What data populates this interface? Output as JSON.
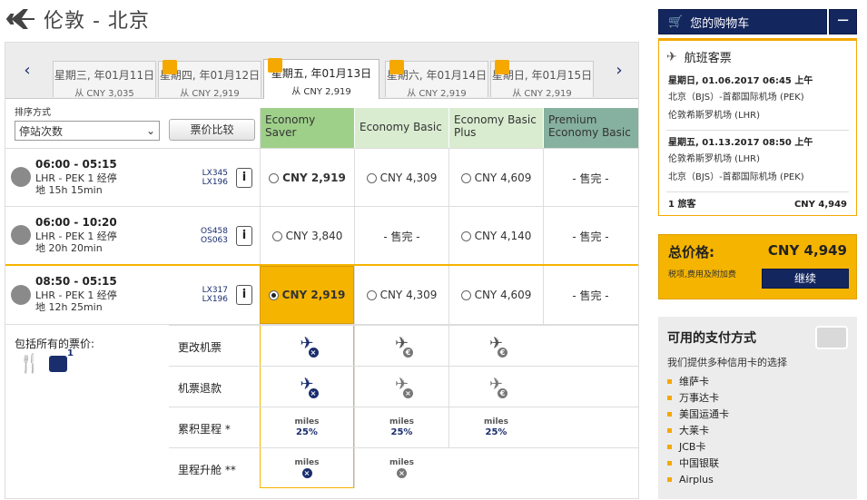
{
  "page": {
    "title": "伦敦 - 北京"
  },
  "datebar": {
    "prev": "‹",
    "next": "›",
    "tabs": [
      {
        "date": "星期三, 年01月11日",
        "price": "从 CNY 3,035",
        "flag": false,
        "selected": false
      },
      {
        "date": "星期四, 年01月12日",
        "price": "从 CNY 2,919",
        "flag": true,
        "selected": false
      },
      {
        "date": "星期五, 年01月13日",
        "price": "从 CNY 2,919",
        "flag": true,
        "selected": true
      },
      {
        "date": "星期六, 年01月14日",
        "price": "从 CNY 2,919",
        "flag": true,
        "selected": false
      },
      {
        "date": "星期日, 年01月15日",
        "price": "从 CNY 2,919",
        "flag": true,
        "selected": false
      }
    ]
  },
  "sort": {
    "label": "排序方式",
    "value": "停站次数",
    "compare_label": "票价比较"
  },
  "fares": [
    {
      "name": "Economy Saver",
      "color": "#9fd08a"
    },
    {
      "name": "Economy Basic",
      "color": "#d9ecd0"
    },
    {
      "name": "Economy Basic Plus",
      "color": "#d9ecd0"
    },
    {
      "name": "Premium Economy Basic",
      "color": "#86b0a0"
    }
  ],
  "flights": [
    {
      "time": "06:00 - 05:15",
      "route": "LHR - PEK",
      "stops": "1 经停",
      "duration": "15h 15min",
      "dur_prefix": "地",
      "numbers": [
        "LX345",
        "LX196"
      ],
      "prices": [
        "CNY 2,919",
        "CNY 4,309",
        "CNY 4,609",
        "- 售完 -"
      ]
    },
    {
      "time": "06:00 - 10:20",
      "route": "LHR - PEK",
      "stops": "1 经停",
      "duration": "20h 20min",
      "dur_prefix": "地",
      "numbers": [
        "OS458",
        "OS063"
      ],
      "prices": [
        "CNY 3,840",
        "- 售完 -",
        "CNY 4,140",
        "- 售完 -"
      ]
    },
    {
      "time": "08:50 - 05:15",
      "route": "LHR - PEK",
      "stops": "1 经停",
      "duration": "12h 25min",
      "dur_prefix": "地",
      "numbers": [
        "LX317",
        "LX196"
      ],
      "prices": [
        "CNY 2,919",
        "CNY 4,309",
        "CNY 4,609",
        "- 售完 -"
      ]
    }
  ],
  "included": {
    "label": "包括所有的票价:",
    "baggage_count": "1"
  },
  "features": [
    {
      "label": "更改机票"
    },
    {
      "label": "机票退款"
    },
    {
      "label": "累积里程 *",
      "miles_word": "miles",
      "values": [
        "25%",
        "25%",
        "25%"
      ]
    },
    {
      "label": "里程升舱 **",
      "miles_word": "miles"
    }
  ],
  "cart": {
    "label": "您的购物车",
    "minus": "−"
  },
  "summary": {
    "title": "航班客票",
    "out_date": "星期日, 01.06.2017 06:45 上午",
    "out_from": "北京（BJS）-首都国际机场 (PEK)",
    "out_to": "伦敦希斯罗机场 (LHR)",
    "ret_date": "星期五, 01.13.2017 08:50 上午",
    "ret_from": "伦敦希斯罗机场 (LHR)",
    "ret_to": "北京（BJS）-首都国际机场 (PEK)",
    "pax": "1 旅客",
    "pax_price": "CNY 4,949"
  },
  "total": {
    "label": "总价格:",
    "value": "CNY 4,949",
    "note": "税项,费用及附加费",
    "continue": "继续"
  },
  "payment": {
    "title": "可用的支付方式",
    "subtitle": "我们提供多种信用卡的选择",
    "methods": [
      "维萨卡",
      "万事达卡",
      "美国运通卡",
      "大莱卡",
      "JCB卡",
      "中国银联",
      "Airplus"
    ]
  },
  "colors": {
    "navy": "#14265e",
    "accent": "#f5b400"
  }
}
